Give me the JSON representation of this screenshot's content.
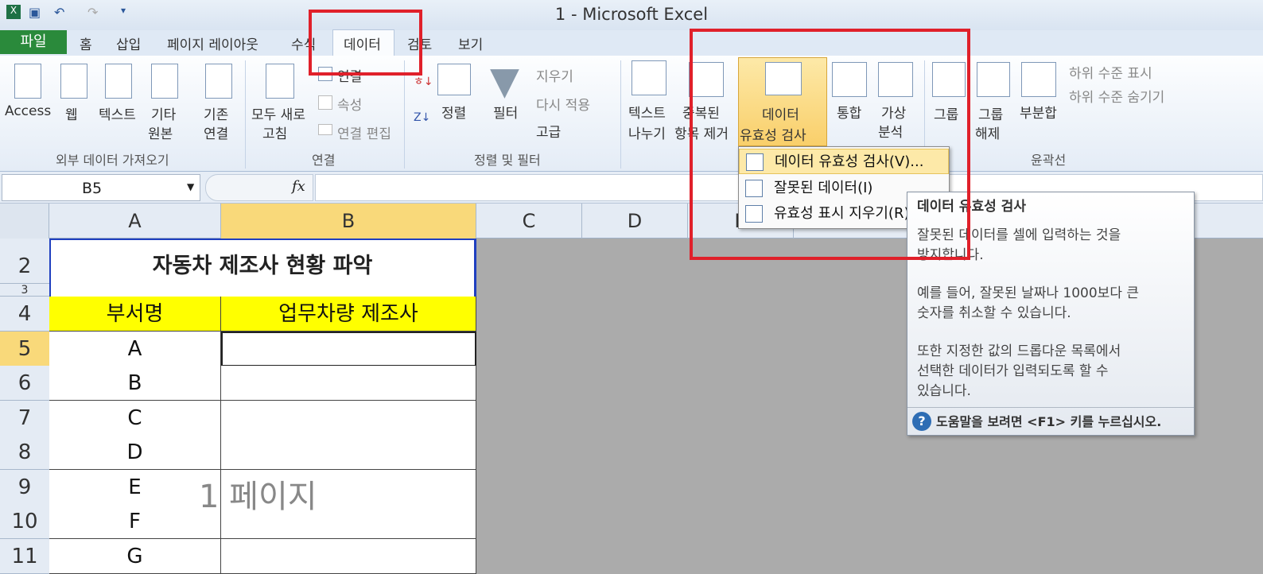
{
  "window": {
    "title": "1 - Microsoft Excel"
  },
  "tabs": [
    "파일",
    "홈",
    "삽입",
    "페이지 레이아웃",
    "수식",
    "데이터",
    "검토",
    "보기"
  ],
  "ribbon": {
    "external": {
      "access": "Access",
      "web": "웹",
      "text": "텍스트",
      "other1": "기타",
      "other2": "원본",
      "existing1": "기존",
      "existing2": "연결",
      "group": "외부 데이터 가져오기"
    },
    "connections": {
      "refresh1": "모두 새로",
      "refresh2": "고침",
      "conn": "연결",
      "props": "속성",
      "edit": "연결 편집",
      "group": "연결"
    },
    "sort": {
      "sort": "정렬",
      "filter": "필터",
      "clear": "지우기",
      "reapply": "다시 적용",
      "advanced": "고급",
      "group": "정렬 및 필터"
    },
    "tools": {
      "t2c1": "텍스트",
      "t2c2": "나누기",
      "dup1": "중복된",
      "dup2": "항목 제거",
      "dv1": "데이터",
      "dv2": "유효성 검사",
      "consolidate": "통합",
      "whatif1": "가상",
      "whatif2": "분석"
    },
    "outline": {
      "group1": "그룹",
      "ungroup1": "그룹",
      "ungroup2": "해제",
      "subtotal": "부분합",
      "show": "하위 수준 표시",
      "hide": "하위 수준 숨기기",
      "group": "윤곽선"
    }
  },
  "formula": {
    "namebox": "B5",
    "fx": "fx"
  },
  "columns": [
    "A",
    "B",
    "C",
    "D",
    "E"
  ],
  "sheet": {
    "title": "자동차 제조사 현황 파악",
    "headers": [
      "부서명",
      "업무차량 제조사"
    ],
    "rows": [
      {
        "n": "5",
        "a": "A"
      },
      {
        "n": "6",
        "a": "B"
      },
      {
        "n": "7",
        "a": "C"
      },
      {
        "n": "8",
        "a": "D"
      },
      {
        "n": "9",
        "a": "E"
      },
      {
        "n": "10",
        "a": "F"
      },
      {
        "n": "11",
        "a": "G"
      }
    ],
    "row_numbers": [
      "2",
      "3",
      "4"
    ],
    "watermark": "1 페이지"
  },
  "menu": {
    "items": [
      "데이터 유효성 검사(V)...",
      "잘못된 데이터(I)",
      "유효성 표시 지우기(R)"
    ]
  },
  "tooltip": {
    "title": "데이터 유효성 검사",
    "p1a": "잘못된 데이터를 셀에 입력하는 것을",
    "p1b": "방지합니다.",
    "p2a": "예를 들어, 잘못된 날짜나 1000보다 큰",
    "p2b": "숫자를 취소할 수 있습니다.",
    "p3a": "또한 지정한 값의 드롭다운 목록에서",
    "p3b": "선택한 데이터가 입력되도록 할 수",
    "p3c": "있습니다.",
    "help": "도움말을 보려면 <F1> 키를 누르십시오."
  },
  "colors": {
    "header_fill": "#ffff00",
    "highlight": "#e0202a",
    "file_tab": "#2a8a3b"
  }
}
